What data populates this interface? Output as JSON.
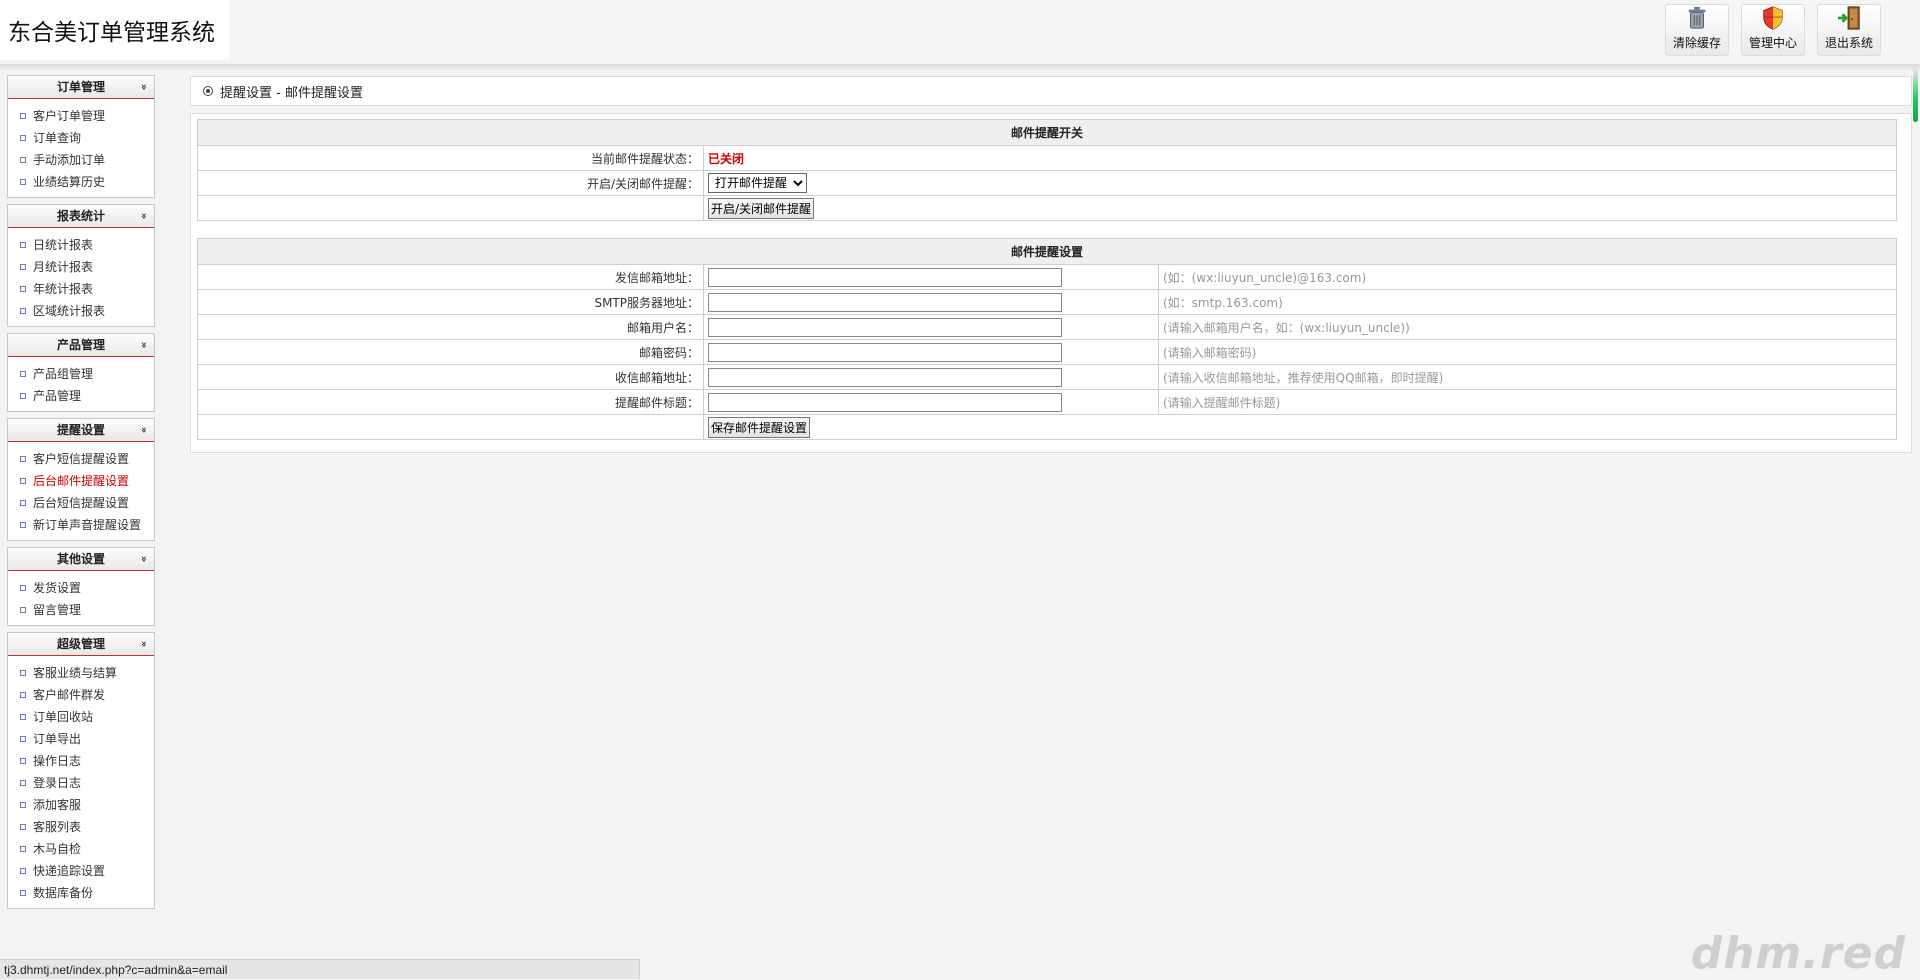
{
  "header": {
    "title": "东合美订单管理系统",
    "buttons": [
      {
        "label": "清除缓存",
        "icon": "trash-can-icon"
      },
      {
        "label": "管理中心",
        "icon": "shield-icon"
      },
      {
        "label": "退出系统",
        "icon": "exit-door-icon"
      }
    ]
  },
  "sidebar": {
    "groups": [
      {
        "title": "订单管理",
        "items": [
          "客户订单管理",
          "订单查询",
          "手动添加订单",
          "业绩结算历史"
        ]
      },
      {
        "title": "报表统计",
        "items": [
          "日统计报表",
          "月统计报表",
          "年统计报表",
          "区域统计报表"
        ]
      },
      {
        "title": "产品管理",
        "items": [
          "产品组管理",
          "产品管理"
        ]
      },
      {
        "title": "提醒设置",
        "items": [
          "客户短信提醒设置",
          "后台邮件提醒设置",
          "后台短信提醒设置",
          "新订单声音提醒设置"
        ]
      },
      {
        "title": "其他设置",
        "items": [
          "发货设置",
          "留言管理"
        ]
      },
      {
        "title": "超级管理",
        "items": [
          "客服业绩与结算",
          "客户邮件群发",
          "订单回收站",
          "订单导出",
          "操作日志",
          "登录日志",
          "添加客服",
          "客服列表",
          "木马自检",
          "快递追踪设置",
          "数据库备份"
        ]
      }
    ],
    "active_item": "后台邮件提醒设置"
  },
  "main": {
    "breadcrumb": "提醒设置 - 邮件提醒设置",
    "switch_section": {
      "header": "邮件提醒开关",
      "status_label": "当前邮件提醒状态：",
      "status_value": "已关闭",
      "toggle_label": "开启/关闭邮件提醒：",
      "toggle_selected": "打开邮件提醒",
      "submit_label": "开启/关闭邮件提醒"
    },
    "settings_section": {
      "header": "邮件提醒设置",
      "fields": [
        {
          "label": "发信邮箱地址：",
          "value": "",
          "hint": "(如：(wx:liuyun_uncle)@163.com)"
        },
        {
          "label": "SMTP服务器地址：",
          "value": "",
          "hint": "(如：smtp.163.com)"
        },
        {
          "label": "邮箱用户名：",
          "value": "",
          "hint": "(请输入邮箱用户名，如：(wx:liuyun_uncle))"
        },
        {
          "label": "邮箱密码：",
          "value": "",
          "hint": "(请输入邮箱密码)"
        },
        {
          "label": "收信邮箱地址：",
          "value": "",
          "hint": "(请输入收信邮箱地址，推荐使用QQ邮箱，即时提醒)"
        },
        {
          "label": "提醒邮件标题：",
          "value": "",
          "hint": "(请输入提醒邮件标题)"
        }
      ],
      "submit_label": "保存邮件提醒设置"
    }
  },
  "statusbar": {
    "url": "tj3.dhmtj.net/index.php?c=admin&a=email"
  },
  "watermark": "dhm.red"
}
